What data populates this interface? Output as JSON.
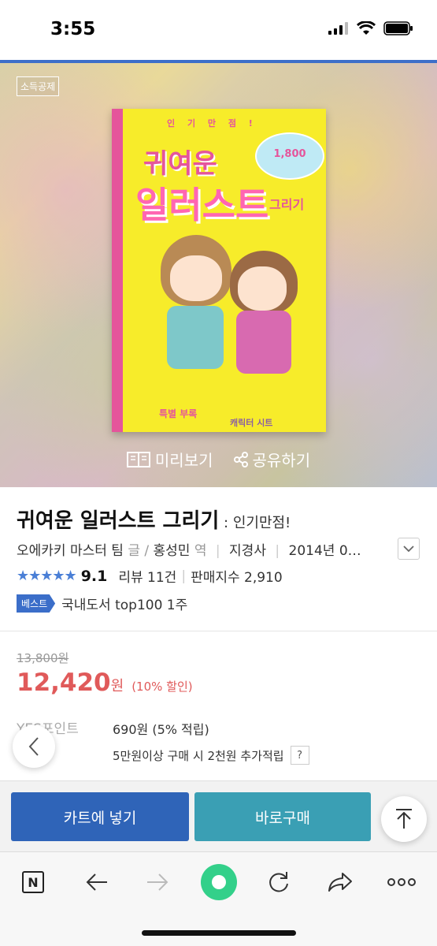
{
  "status": {
    "time": "3:55"
  },
  "hero": {
    "tax_badge": "소득공제",
    "preview_label": "미리보기",
    "share_label": "공유하기",
    "cover": {
      "tag": "인 기 만 점 !",
      "title1": "귀여운",
      "title2": "일러스트",
      "title3": "그리기",
      "bubble": "1,800",
      "bottom1": "특별 부록",
      "bottom2": "캐릭터 시트"
    }
  },
  "product": {
    "title": "귀여운 일러스트 그리기",
    "subtitle": " : 인기만점!",
    "author": "오에카키 마스터 팀",
    "author_role": "글",
    "translator": "홍성민",
    "translator_role": "역",
    "publisher": "지경사",
    "date": "2014년 0…",
    "stars": "★★★★★",
    "score": "9.1",
    "review_label": "리뷰 11건",
    "sales_label": "판매지수 2,910",
    "best_badge": "베스트",
    "best_text": "국내도서 top100 1주"
  },
  "price": {
    "original": "13,800원",
    "sale": "12,420",
    "won": "원",
    "discount": "(10% 할인)",
    "points_label": "YES포인트",
    "points_value": "690원 (5% 적립)",
    "points_note": "5만원이상 구매 시 2천원 추가적립",
    "help": "?"
  },
  "actions": {
    "cart": "카트에 넣기",
    "buy": "바로구매"
  },
  "nav": {
    "n_label": "N"
  }
}
